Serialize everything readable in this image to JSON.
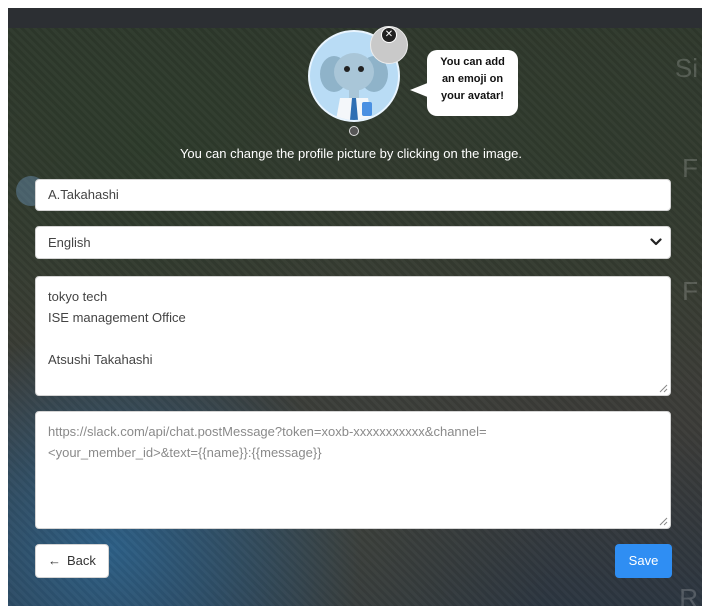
{
  "profile": {
    "bubble_lines": [
      "You can add",
      "an emoji on",
      "your avatar!"
    ],
    "close_symbol": "✕",
    "hint": "You can change the profile picture by clicking on the image.",
    "name_value": "A.Takahashi",
    "language_value": "English",
    "bio_lines": [
      "tokyo tech",
      "ISE management Office",
      "",
      "Atsushi Takahashi"
    ],
    "webhook_line1": "https://slack.com/api/chat.postMessage?token=xoxb-xxxxxxxxxxx&channel=",
    "webhook_line2": "<your_member_id>&text={{name}}:{{message}}",
    "back_arrow": "←",
    "back_label": "Back",
    "save_label": "Save"
  },
  "colors": {
    "accent": "#2f8ef3",
    "avatar_bg": "#b9dcf5"
  },
  "icons": [
    "close-icon",
    "chevron-down-icon",
    "arrow-left-icon",
    "resize-handle-icon",
    "elephant-avatar-icon"
  ]
}
